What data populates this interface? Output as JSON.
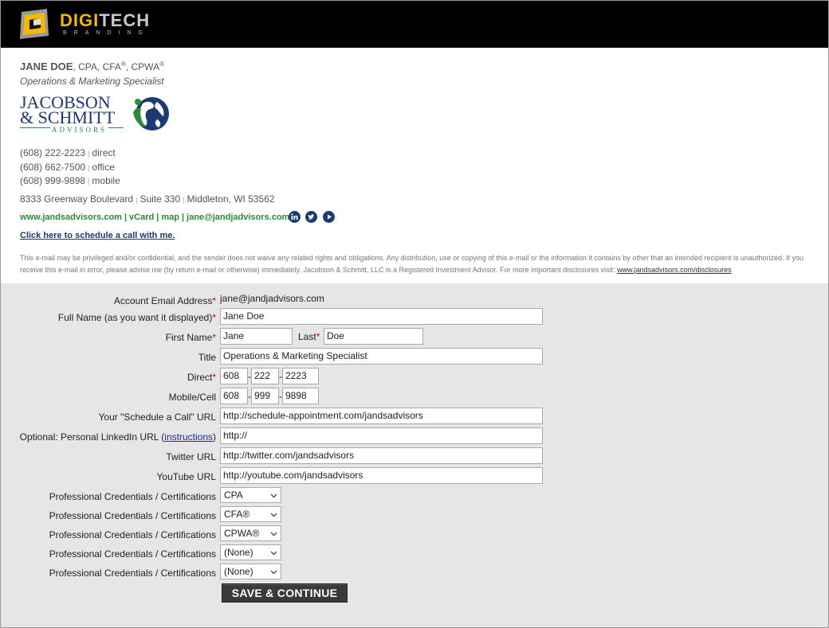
{
  "brand": {
    "name_primary": "DIGI",
    "name_secondary": "TECH",
    "tagline": "BRANDING",
    "accent_color": "#f5b800"
  },
  "signature": {
    "name": "JANE DOE",
    "credentials_prefix": ", CPA, CFA",
    "reg1": "®",
    "credentials_mid": ", CPWA",
    "reg2": "®",
    "title": "Operations & Marketing Specialist",
    "firm_line1": "JACOBSON",
    "firm_line2": "& SCHMITT",
    "firm_sub": "ADVISORS",
    "phones": [
      {
        "number": "(608) 222-2223",
        "type": "direct"
      },
      {
        "number": "(608) 662-7500",
        "type": "office"
      },
      {
        "number": "(608) 999-9898",
        "type": "mobile"
      }
    ],
    "address": {
      "street": "8333 Greenway Boulevard",
      "suite": "Suite 330",
      "city": "Middleton, WI 53562"
    },
    "links": {
      "website": "www.jandsadvisors.com",
      "vcard": "vCard",
      "map": "map",
      "email": "jane@jandjadvisors.com"
    },
    "social_icons": [
      "linkedin-icon",
      "twitter-icon",
      "youtube-icon"
    ],
    "schedule_link": "Click here to schedule a call with me.",
    "disclaimer": "This e-mail may be privileged and/or confidential, and the sender does not waive any related rights and obligations. Any distribution, use or copying of this e-mail or the information it contains by other that an intended recipient is unauthorized. If you receive this e-mail in error, please advise me (by return e-mail or otherwise) immediately. Jacobson & Schmitt, LLC is a Registered Investment Advisor. For more important disclosures visit: ",
    "disclosure_link": "www.jandsadvisors.com/disclosures",
    "brand_color": "#1c3a73",
    "link_color": "#2a8b36"
  },
  "form": {
    "account_email": {
      "label": "Account Email Address",
      "value": "jane@jandjadvisors.com"
    },
    "full_name": {
      "label": "Full Name (as you want it displayed)",
      "value": "Jane Doe"
    },
    "first_name": {
      "label": "First Name",
      "value": "Jane"
    },
    "last_name": {
      "label": "Last",
      "value": "Doe"
    },
    "title": {
      "label": "Title",
      "value": "Operations & Marketing Specialist"
    },
    "direct": {
      "label": "Direct",
      "area": "608",
      "prefix": "222",
      "line": "2223"
    },
    "mobile": {
      "label": "Mobile/Cell",
      "area": "608",
      "prefix": "999",
      "line": "9898"
    },
    "schedule_url": {
      "label": "Your \"Schedule a Call\" URL",
      "value": "http://schedule-appointment.com/jandsadvisors"
    },
    "linkedin_url": {
      "label_prefix": "Optional: Personal LinkedIn URL (",
      "label_link": "instructions",
      "label_suffix": ")",
      "value": "http://"
    },
    "twitter_url": {
      "label": "Twitter URL",
      "value": "http://twitter.com/jandsadvisors"
    },
    "youtube_url": {
      "label": "YouTube URL",
      "value": "http://youtube.com/jandsadvisors"
    },
    "credentials_label": "Professional Credentials / Certifications",
    "credentials": [
      "CPA",
      "CFA®",
      "CPWA®",
      "(None)",
      "(None)"
    ],
    "required_mark": "*",
    "dash": "-",
    "save_label": "SAVE & CONTINUE"
  }
}
